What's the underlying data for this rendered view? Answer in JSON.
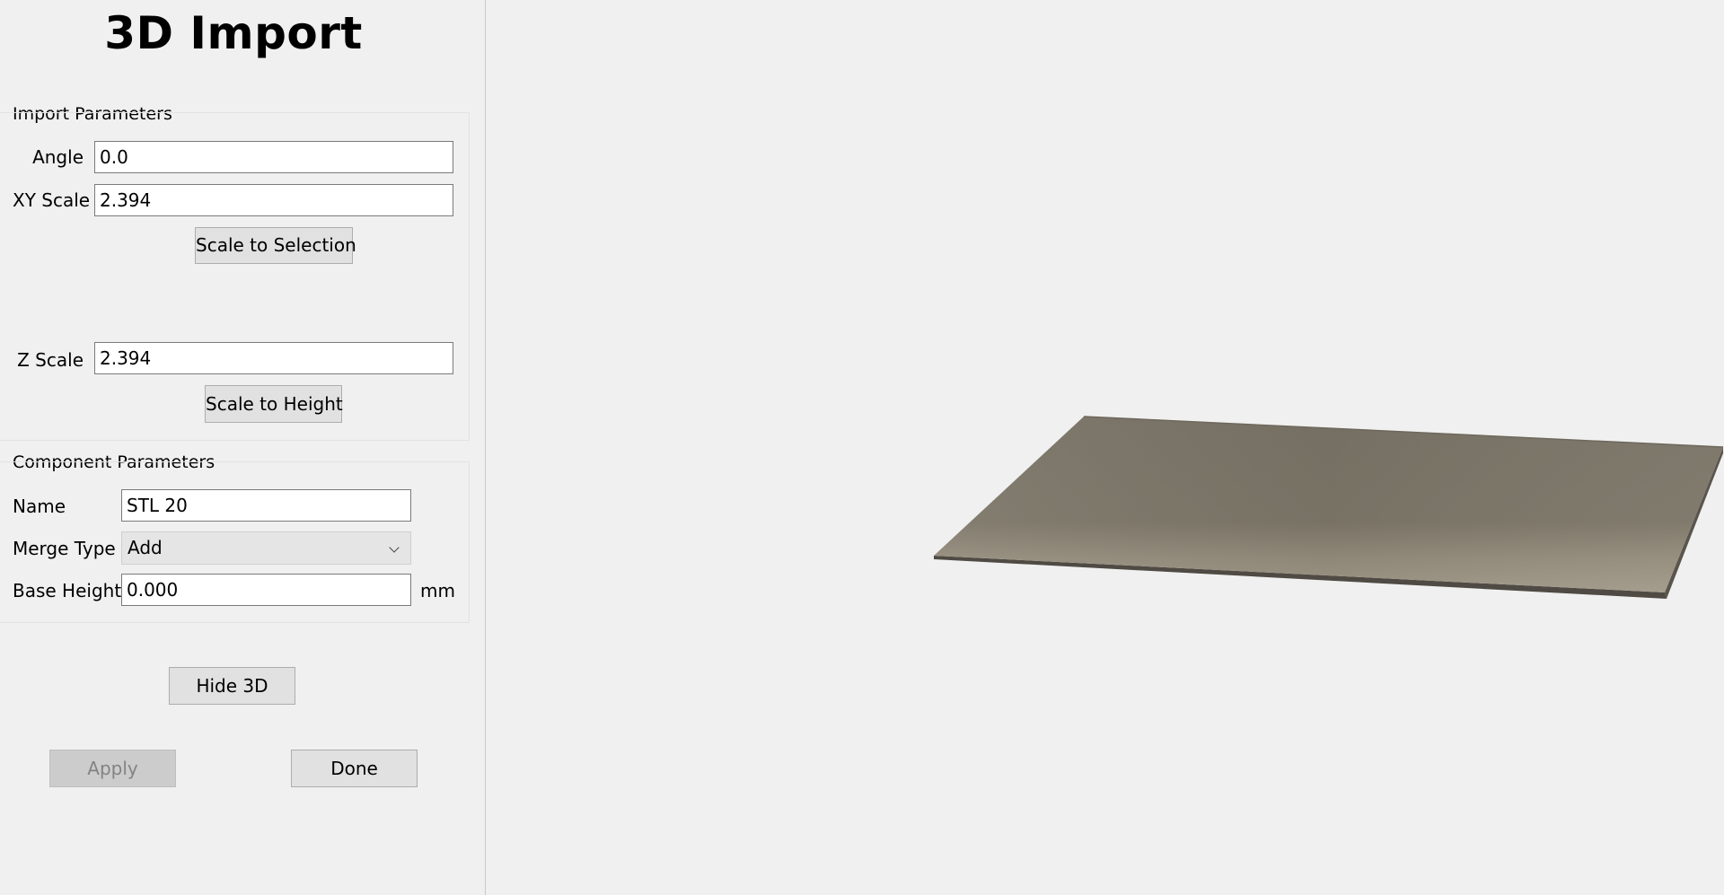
{
  "title": "3D Import",
  "import_parameters": {
    "title": "Import Parameters",
    "angle_label": "Angle",
    "angle_value": "0.0",
    "xy_scale_label": "XY Scale",
    "xy_scale_value": "2.394",
    "scale_to_selection_label": "Scale to Selection",
    "z_scale_label": "Z Scale",
    "z_scale_value": "2.394",
    "scale_to_height_label": "Scale to Height"
  },
  "component_parameters": {
    "title": "Component Parameters",
    "name_label": "Name",
    "name_value": "STL 20",
    "merge_type_label": "Merge Type",
    "merge_type_value": "Add",
    "base_height_label": "Base Height",
    "base_height_value": "0.000",
    "base_height_unit": "mm"
  },
  "buttons": {
    "hide_3d": "Hide 3D",
    "apply": "Apply",
    "done": "Done"
  },
  "viewport": {
    "model_colors": {
      "top_dark": "#7a7467",
      "top_light": "#9f9787",
      "edge": "#4f4b44"
    }
  }
}
